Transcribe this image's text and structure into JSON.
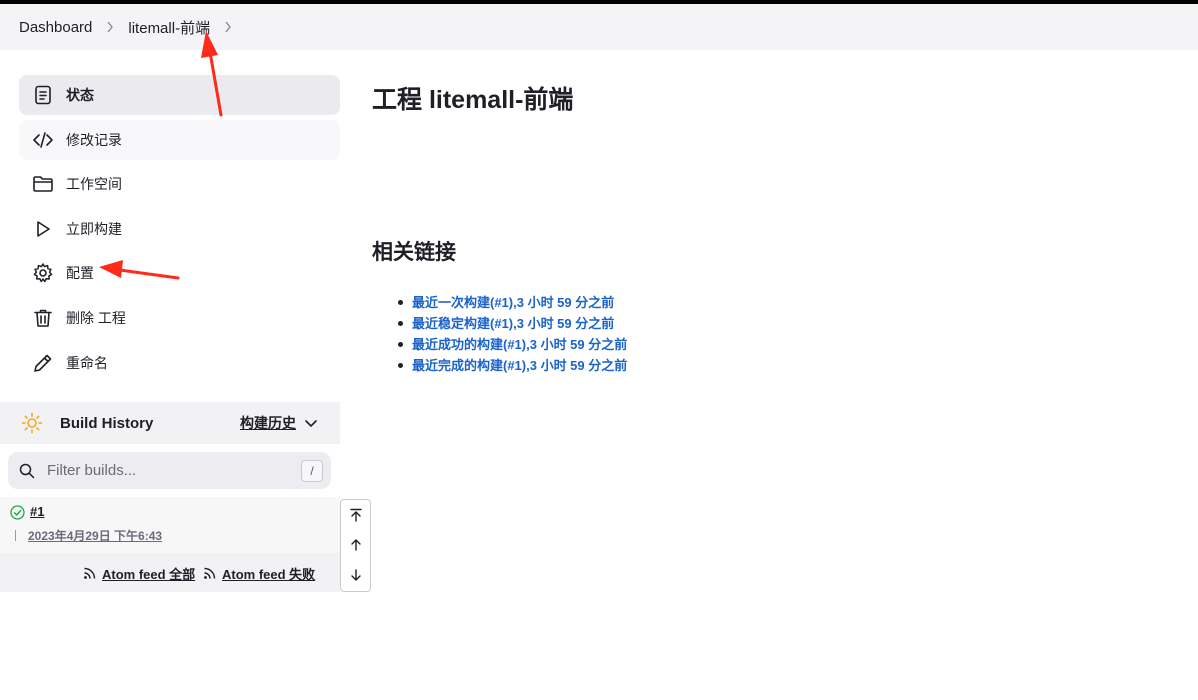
{
  "breadcrumb": {
    "items": [
      "Dashboard",
      "litemall-前端"
    ]
  },
  "side_panel": {
    "tasks": [
      {
        "label": "状态",
        "icon": "document-icon"
      },
      {
        "label": "修改记录",
        "icon": "code-icon"
      },
      {
        "label": "工作空间",
        "icon": "folder-icon"
      },
      {
        "label": "立即构建",
        "icon": "play-icon"
      },
      {
        "label": "配置",
        "icon": "gear-icon"
      },
      {
        "label": "删除 工程",
        "icon": "trash-icon"
      },
      {
        "label": "重命名",
        "icon": "pencil-icon"
      }
    ]
  },
  "build_history": {
    "title": "Build History",
    "trend_label": "构建历史",
    "filter_placeholder": "Filter builds...",
    "filter_shortcut": "/",
    "builds": [
      {
        "number": "#1",
        "date": "2023年4月29日 下午6:43",
        "status": "success"
      }
    ],
    "feeds": {
      "all": "Atom feed 全部",
      "failed": "Atom feed 失败"
    }
  },
  "main": {
    "title": "工程 litemall-前端",
    "related_title": "相关链接",
    "links": [
      "最近一次构建(#1),3 小时 59 分之前",
      "最近稳定构建(#1),3 小时 59 分之前",
      "最近成功的构建(#1),3 小时 59 分之前",
      "最近完成的构建(#1),3 小时 59 分之前"
    ]
  },
  "colors": {
    "link": "#1a63c9",
    "annotation_arrow": "#ff2a1a",
    "success": "#1ea446",
    "sun": "#f5a623"
  }
}
